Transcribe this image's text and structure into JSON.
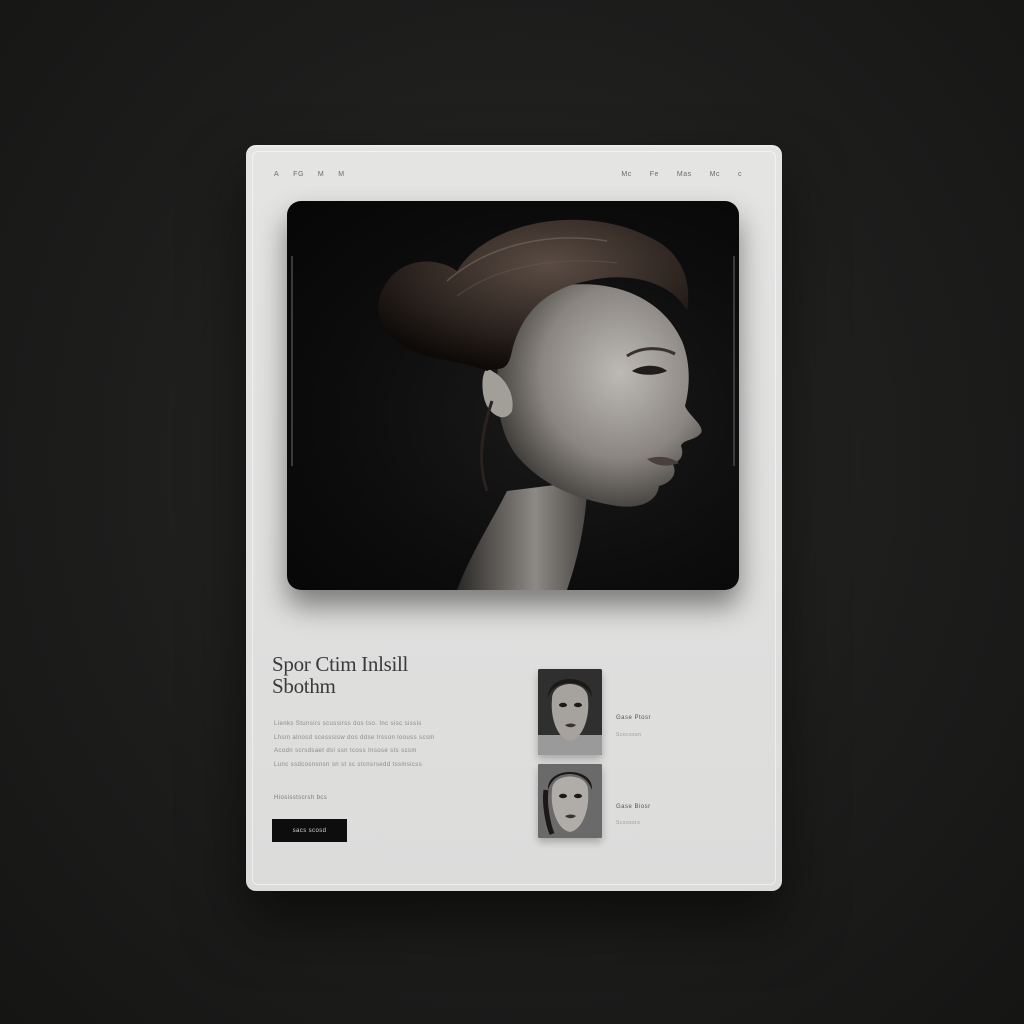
{
  "nav": {
    "left": [
      "A",
      "FG",
      "M",
      "M"
    ],
    "right": [
      "Mc",
      "Fe",
      "Mas",
      "Mc",
      "c"
    ]
  },
  "hero": {
    "image": "woman-profile-portrait-bw"
  },
  "headline": {
    "line1": "Spor Ctim  Inlsill",
    "line2": "Sbothm"
  },
  "body": {
    "lines": [
      "Lienks Stunsirs scussirss dos tso. Inc sisc sissis",
      "Lhsm alnosd scesssisw dos ddse lrsson loouss scsm",
      "Acodn scrsdsaet dsl ssn tcoss Insose sts scsm",
      "Lunc ssdcosnsnsn sn st sc stcnsrsedd tssmsicss"
    ],
    "byline": "Hiosisstscrsh bcs"
  },
  "cta": {
    "label": "sacs scosd"
  },
  "features": [
    {
      "title": "Gase  Ptosr",
      "subtitle": "Scocsssn",
      "image": "portrait-thumbnail-1"
    },
    {
      "title": "Gase  Biosr",
      "subtitle": "Scsossrs",
      "image": "portrait-thumbnail-2"
    }
  ],
  "colors": {
    "page_bg": "#1d1d1c",
    "card_bg": "#e0e0df",
    "hero_bg": "#0c0c0c",
    "button_bg": "#0d0d0d"
  }
}
